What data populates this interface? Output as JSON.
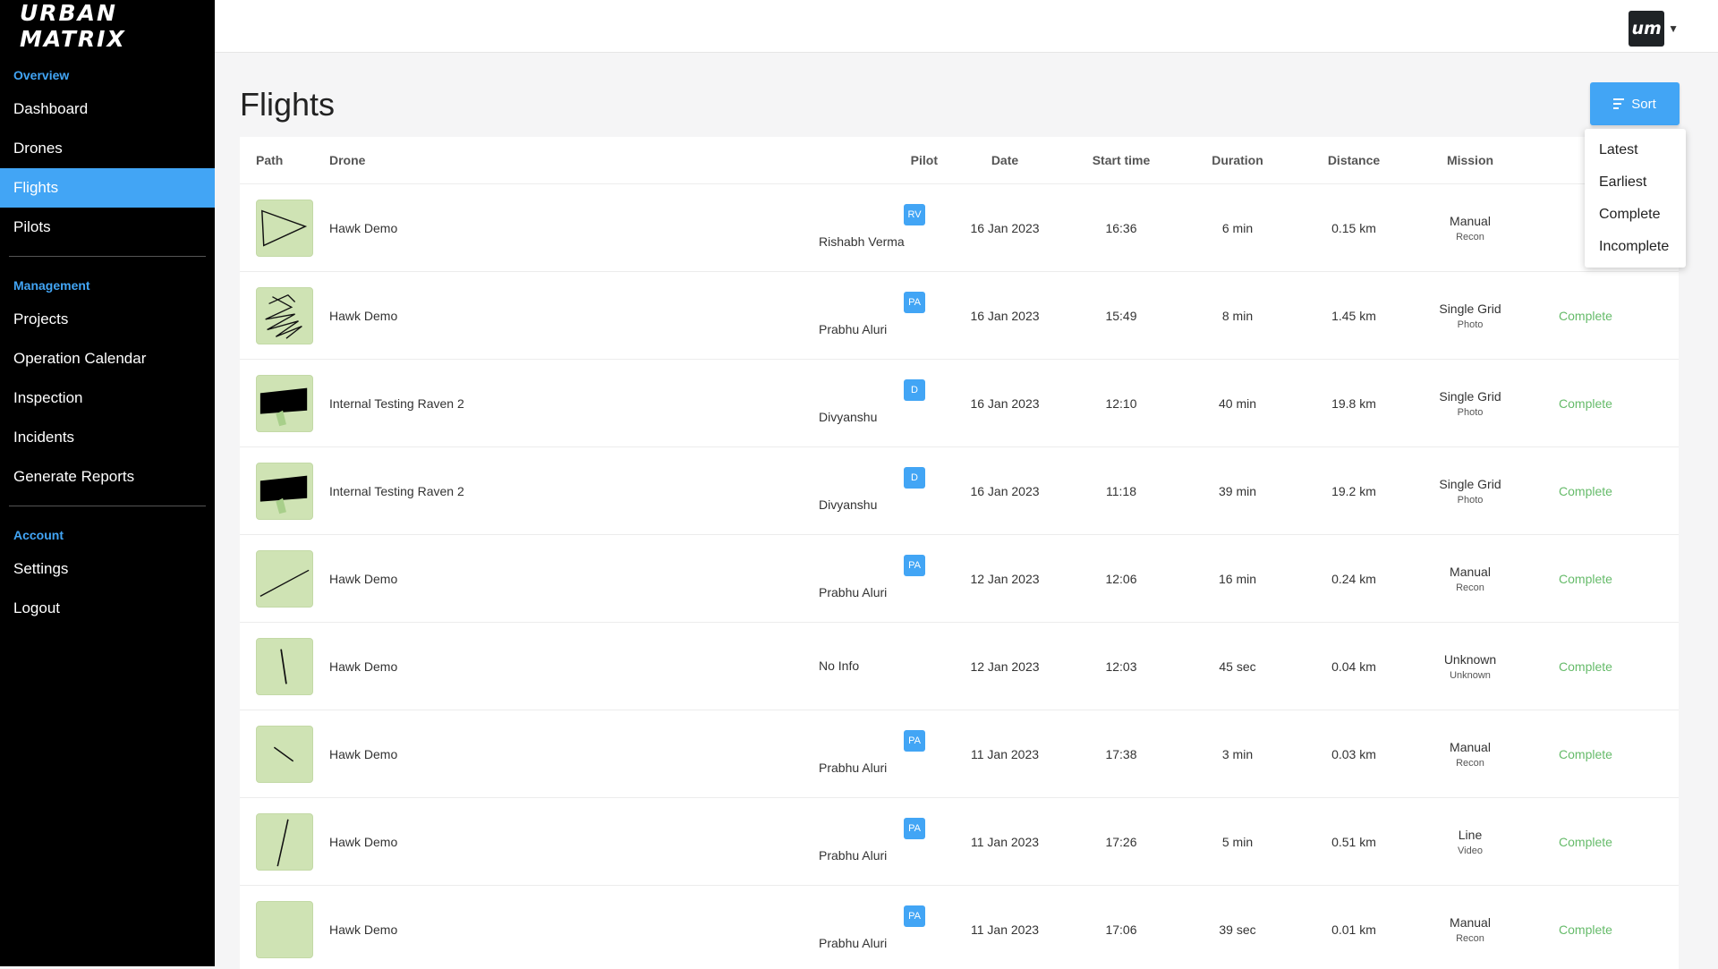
{
  "brand": {
    "logo_text": "URBAN MATRIX",
    "avatar_text": "um",
    "accent": "#42a5f5",
    "status_color": "#66bb6a"
  },
  "sidebar": {
    "sections": [
      {
        "title": "Overview",
        "items": [
          {
            "label": "Dashboard"
          },
          {
            "label": "Drones"
          },
          {
            "label": "Flights",
            "active": true
          },
          {
            "label": "Pilots"
          }
        ]
      },
      {
        "title": "Management",
        "items": [
          {
            "label": "Projects"
          },
          {
            "label": "Operation Calendar"
          },
          {
            "label": "Inspection"
          },
          {
            "label": "Incidents"
          },
          {
            "label": "Generate Reports"
          }
        ]
      },
      {
        "title": "Account",
        "items": [
          {
            "label": "Settings"
          },
          {
            "label": "Logout"
          }
        ]
      }
    ]
  },
  "page": {
    "title": "Flights",
    "sort_label": "Sort"
  },
  "sort_menu": [
    "Latest",
    "Earliest",
    "Complete",
    "Incomplete"
  ],
  "table": {
    "headers": {
      "path": "Path",
      "drone": "Drone",
      "pilot": "Pilot",
      "date": "Date",
      "start": "Start time",
      "duration": "Duration",
      "distance": "Distance",
      "mission": "Mission"
    },
    "rows": [
      {
        "path": "triangle",
        "drone": "Hawk Demo",
        "pilot_initials": "RV",
        "pilot": "Rishabh Verma",
        "date": "16 Jan 2023",
        "start": "16:36",
        "duration": "6 min",
        "distance": "0.15 km",
        "mission": "Manual",
        "mission_sub": "Recon",
        "status": ""
      },
      {
        "path": "grid",
        "drone": "Hawk Demo",
        "pilot_initials": "PA",
        "pilot": "Prabhu Aluri",
        "date": "16 Jan 2023",
        "start": "15:49",
        "duration": "8 min",
        "distance": "1.45 km",
        "mission": "Single Grid",
        "mission_sub": "Photo",
        "status": "Complete"
      },
      {
        "path": "block",
        "drone": "Internal Testing Raven 2",
        "pilot_initials": "D",
        "pilot": "Divyanshu",
        "date": "16 Jan 2023",
        "start": "12:10",
        "duration": "40 min",
        "distance": "19.8 km",
        "mission": "Single Grid",
        "mission_sub": "Photo",
        "status": "Complete"
      },
      {
        "path": "block",
        "drone": "Internal Testing Raven 2",
        "pilot_initials": "D",
        "pilot": "Divyanshu",
        "date": "16 Jan 2023",
        "start": "11:18",
        "duration": "39 min",
        "distance": "19.2 km",
        "mission": "Single Grid",
        "mission_sub": "Photo",
        "status": "Complete"
      },
      {
        "path": "diag",
        "drone": "Hawk Demo",
        "pilot_initials": "PA",
        "pilot": "Prabhu Aluri",
        "date": "12 Jan 2023",
        "start": "12:06",
        "duration": "16 min",
        "distance": "0.24 km",
        "mission": "Manual",
        "mission_sub": "Recon",
        "status": "Complete"
      },
      {
        "path": "vline",
        "drone": "Hawk Demo",
        "pilot_initials": "",
        "pilot": "No Info",
        "date": "12 Jan 2023",
        "start": "12:03",
        "duration": "45 sec",
        "distance": "0.04 km",
        "mission": "Unknown",
        "mission_sub": "Unknown",
        "status": "Complete"
      },
      {
        "path": "short",
        "drone": "Hawk Demo",
        "pilot_initials": "PA",
        "pilot": "Prabhu Aluri",
        "date": "11 Jan 2023",
        "start": "17:38",
        "duration": "3 min",
        "distance": "0.03 km",
        "mission": "Manual",
        "mission_sub": "Recon",
        "status": "Complete"
      },
      {
        "path": "curve",
        "drone": "Hawk Demo",
        "pilot_initials": "PA",
        "pilot": "Prabhu Aluri",
        "date": "11 Jan 2023",
        "start": "17:26",
        "duration": "5 min",
        "distance": "0.51 km",
        "mission": "Line",
        "mission_sub": "Video",
        "status": "Complete"
      },
      {
        "path": "empty",
        "drone": "Hawk Demo",
        "pilot_initials": "PA",
        "pilot": "Prabhu Aluri",
        "date": "11 Jan 2023",
        "start": "17:06",
        "duration": "39 sec",
        "distance": "0.01 km",
        "mission": "Manual",
        "mission_sub": "Recon",
        "status": "Complete"
      }
    ]
  }
}
